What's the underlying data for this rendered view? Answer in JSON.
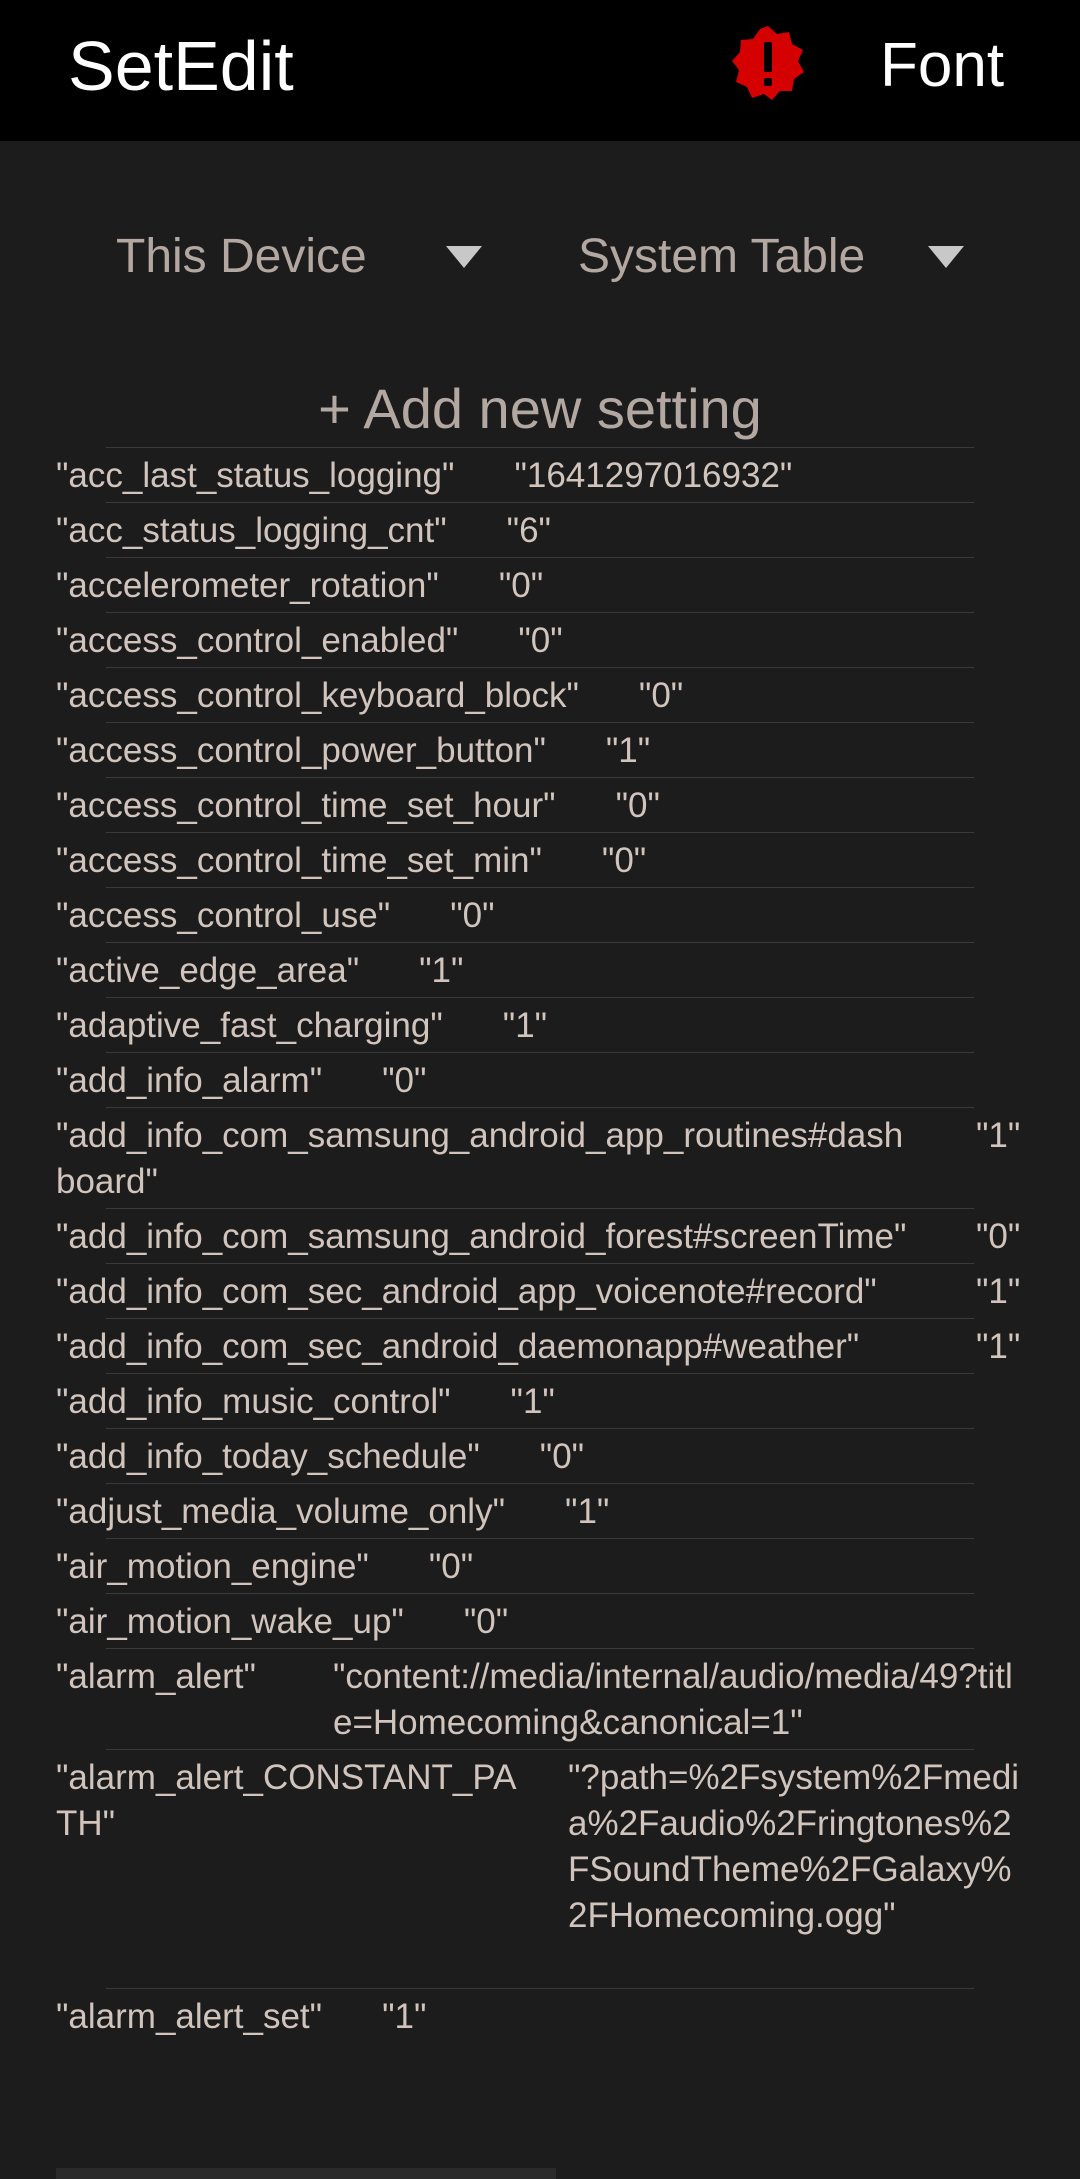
{
  "appbar": {
    "title": "SetEdit",
    "alert_icon": "alert-badge-icon",
    "font_label": "Font",
    "alert_color": "#d50000"
  },
  "selectors": {
    "device": "This Device",
    "table": "System Table"
  },
  "add_setting_label": "+ Add new setting",
  "settings": [
    {
      "key": "\"acc_last_status_logging\"",
      "value": "\"1641297016932\""
    },
    {
      "key": "\"acc_status_logging_cnt\"",
      "value": "\"6\""
    },
    {
      "key": "\"accelerometer_rotation\"",
      "value": "\"0\""
    },
    {
      "key": "\"access_control_enabled\"",
      "value": "\"0\""
    },
    {
      "key": "\"access_control_keyboard_block\"",
      "value": "\"0\""
    },
    {
      "key": "\"access_control_power_button\"",
      "value": "\"1\""
    },
    {
      "key": "\"access_control_time_set_hour\"",
      "value": "\"0\""
    },
    {
      "key": "\"access_control_time_set_min\"",
      "value": "\"0\""
    },
    {
      "key": "\"access_control_use\"",
      "value": "\"0\""
    },
    {
      "key": "\"active_edge_area\"",
      "value": "\"1\""
    },
    {
      "key": "\"adaptive_fast_charging\"",
      "value": "\"1\""
    },
    {
      "key": "\"add_info_alarm\"",
      "value": "\"0\""
    },
    {
      "key": "\"add_info_com_samsung_android_app_routines#dashboard\"",
      "value": "\"1\""
    },
    {
      "key": "\"add_info_com_samsung_android_forest#screenTime\"",
      "value": "\"0\""
    },
    {
      "key": "\"add_info_com_sec_android_app_voicenote#record\"",
      "value": "\"1\""
    },
    {
      "key": "\"add_info_com_sec_android_daemonapp#weather\"",
      "value": "\"1\""
    },
    {
      "key": "\"add_info_music_control\"",
      "value": "\"1\""
    },
    {
      "key": "\"add_info_today_schedule\"",
      "value": "\"0\""
    },
    {
      "key": "\"adjust_media_volume_only\"",
      "value": "\"1\""
    },
    {
      "key": "\"air_motion_engine\"",
      "value": "\"0\""
    },
    {
      "key": "\"air_motion_wake_up\"",
      "value": "\"0\""
    },
    {
      "key": "\"alarm_alert\"",
      "value": "\"content://media/internal/audio/media/49?title=Homecoming&canonical=1\""
    },
    {
      "key": "\"alarm_alert_CONSTANT_PATH\"",
      "value": "\"?path=%2Fsystem%2Fmedia%2Faudio%2Fringtones%2FSoundTheme%2FGalaxy%2FHomecoming.ogg\""
    },
    {
      "key": "\"alarm_alert_set\"",
      "value": "\"1\""
    }
  ]
}
